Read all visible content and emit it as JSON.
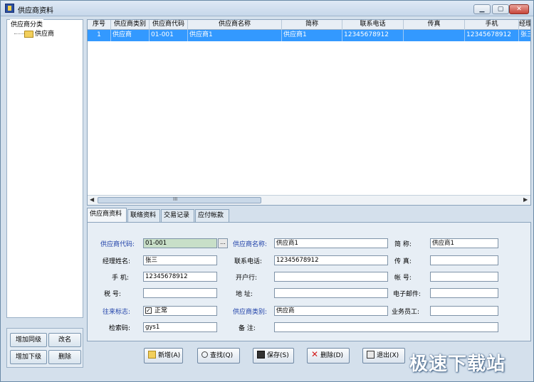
{
  "window": {
    "title": "供应商资料"
  },
  "tree": {
    "header": "供应商分类",
    "root_label": "供应商"
  },
  "side_buttons": {
    "add_same_level": "增加同级",
    "rename": "改名",
    "add_sub_level": "增加下级",
    "delete": "删除"
  },
  "grid": {
    "columns": [
      "序号",
      "供应商类别",
      "供应商代码",
      "供应商名称",
      "简称",
      "联系电话",
      "传真",
      "手机",
      "经理"
    ],
    "row": [
      "1",
      "供应商",
      "01-001",
      "供应商1",
      "供应商1",
      "12345678912",
      "",
      "12345678912",
      "张三"
    ],
    "scroll_thumb_label": "III"
  },
  "tabs": [
    "供应商资料",
    "联络资料",
    "交易记录",
    "应付帐款"
  ],
  "form": {
    "code_label": "供应商代码:",
    "code_value": "01-001",
    "lookup_label": "...",
    "name_label": "供应商名称:",
    "name_value": "供应商1",
    "short_label": "简 称:",
    "short_value": "供应商1",
    "manager_label": "经理姓名:",
    "manager_value": "张三",
    "phone_label": "联系电话:",
    "phone_value": "12345678912",
    "fax_label": "传 真:",
    "fax_value": "",
    "mobile_label": "手 机:",
    "mobile_value": "12345678912",
    "bank_label": "开户行:",
    "bank_value": "",
    "account_label": "帐 号:",
    "account_value": "",
    "tax_label": "税 号:",
    "tax_value": "",
    "address_label": "地 址:",
    "address_value": "",
    "email_label": "电子邮件:",
    "email_value": "",
    "status_label": "往来标志:",
    "status_check": "✓",
    "status_value": "正常",
    "category_label": "供应商类别:",
    "category_value": "供应商",
    "staff_label": "业务员工:",
    "staff_value": "",
    "search_label": "检索码:",
    "search_value": "gys1",
    "remark_label": "备 注:",
    "remark_value": ""
  },
  "actions": {
    "new": "新增(A)",
    "find": "查找(Q)",
    "save": "保存(S)",
    "delete": "删除(D)",
    "exit": "退出(X)"
  },
  "watermark": "极速下载站",
  "colors": {
    "selection": "#3399ff",
    "label_blue": "#1d3fa8",
    "code_field": "#c8dfc8"
  }
}
